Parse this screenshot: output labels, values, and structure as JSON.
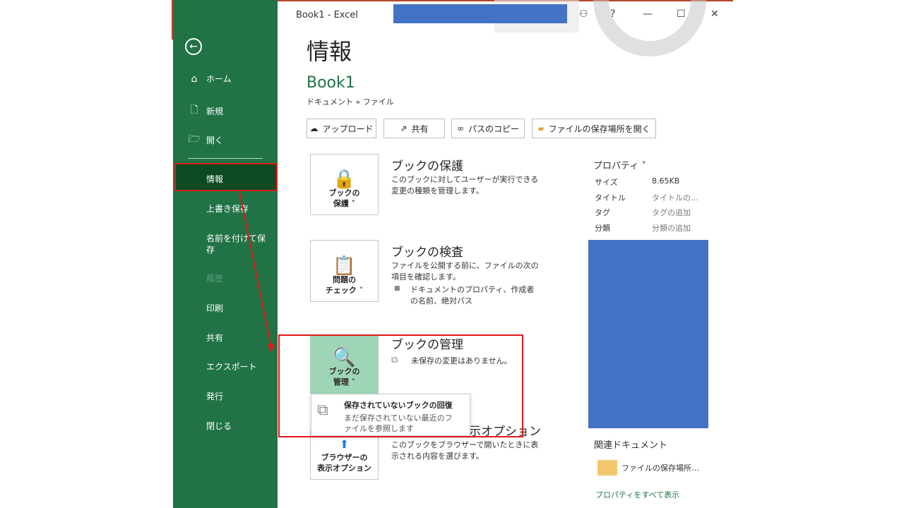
{
  "titlebar": {
    "title": "Book1  -  Excel"
  },
  "sidebar": {
    "items": [
      {
        "label": "ホーム",
        "icon": "home-icon"
      },
      {
        "label": "新規",
        "icon": "new-file-icon"
      },
      {
        "label": "開く",
        "icon": "folder-open-icon"
      },
      {
        "label": "情報"
      },
      {
        "label": "上書き保存"
      },
      {
        "label": "名前を付けて保存"
      },
      {
        "label": "履歴"
      },
      {
        "label": "印刷"
      },
      {
        "label": "共有"
      },
      {
        "label": "エクスポート"
      },
      {
        "label": "発行"
      },
      {
        "label": "閉じる"
      }
    ]
  },
  "main": {
    "page_title": "情報",
    "book_title": "Book1",
    "breadcrumb": "ドキュメント » ファイル",
    "toolbar": {
      "upload": "アップロード",
      "share": "共有",
      "copy_path": "パスのコピー",
      "open_location": "ファイルの保存場所を開く"
    },
    "sections": {
      "protect": {
        "card_label_1": "ブックの",
        "card_label_2": "保護 ˅",
        "title": "ブックの保護",
        "desc": "このブックに対してユーザーが実行できる変更の種類を管理します。"
      },
      "inspect": {
        "card_label_1": "問題の",
        "card_label_2": "チェック ˅",
        "title": "ブックの検査",
        "desc": "ファイルを公開する前に、ファイルの次の項目を確認します。",
        "bullet": "ドキュメントのプロパティ、作成者の名前、絶対パス"
      },
      "manage": {
        "card_label_1": "ブックの",
        "card_label_2": "管理 ˅",
        "title": "ブックの管理",
        "desc": "未保存の変更はありません。"
      },
      "browser": {
        "card_label_1": "ブラウザーの",
        "card_label_2": "表示オプション",
        "title": "示オプション",
        "desc": "このブックをブラウザーで開いたときに表示される内容を選びます。"
      }
    },
    "dropdown": {
      "title": "保存されていないブックの回復",
      "desc": "まだ保存されていない最近のファイルを参照します"
    }
  },
  "properties": {
    "header": "プロパティ ˅",
    "rows": [
      {
        "label": "サイズ",
        "value": "8.65KB"
      },
      {
        "label": "タイトル",
        "value": "タイトルの…"
      },
      {
        "label": "タグ",
        "value": "タグの追加"
      },
      {
        "label": "分類",
        "value": "分類の追加"
      }
    ],
    "related_header": "関連ドキュメント",
    "related_file": "ファイルの保存場所…",
    "all_props": "プロパティをすべて表示"
  },
  "colors": {
    "excel_green": "#217346",
    "selected_green": "#0b4a22",
    "annotation_red": "#e0181b",
    "redaction_blue": "#4472c4"
  }
}
